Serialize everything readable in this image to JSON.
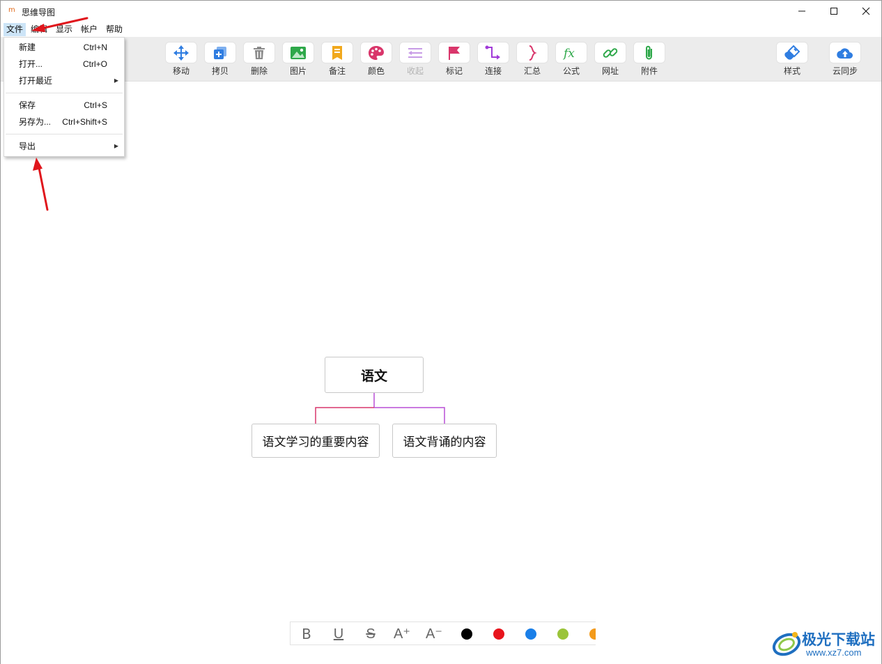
{
  "window": {
    "app_icon": "m",
    "title": "思维导图",
    "controls": {
      "minimize": "minimize-icon",
      "maximize": "maximize-icon",
      "close": "close-icon"
    }
  },
  "menubar": {
    "items": [
      {
        "label": "文件",
        "active": true
      },
      {
        "label": "编辑"
      },
      {
        "label": "显示"
      },
      {
        "label": "帐户"
      },
      {
        "label": "帮助"
      }
    ]
  },
  "toolbar": {
    "tools": [
      {
        "label": "移动",
        "icon": "move-arrows-icon",
        "color": "#2f7de1"
      },
      {
        "label": "拷贝",
        "icon": "copy-icon",
        "color": "#2f7de1"
      },
      {
        "label": "删除",
        "icon": "trash-icon",
        "color": "#8a8a8a"
      },
      {
        "label": "图片",
        "icon": "image-icon",
        "color": "#2ea84a"
      },
      {
        "label": "备注",
        "icon": "note-icon",
        "color": "#f1a81c"
      },
      {
        "label": "颜色",
        "icon": "palette-icon",
        "color": "#d9366b"
      },
      {
        "label": "收起",
        "icon": "collapse-icon",
        "color": "#c79be6",
        "disabled": true
      },
      {
        "label": "标记",
        "icon": "flag-icon",
        "color": "#d9366b"
      },
      {
        "label": "连接",
        "icon": "connect-icon",
        "color": "#a13ad8"
      },
      {
        "label": "汇总",
        "icon": "summary-brace-icon",
        "color": "#d9366b"
      },
      {
        "label": "公式",
        "icon": "formula-icon",
        "color": "#2ea84a"
      },
      {
        "label": "网址",
        "icon": "link-icon",
        "color": "#2ea84a"
      },
      {
        "label": "附件",
        "icon": "paperclip-icon",
        "color": "#2ea84a"
      },
      {
        "label": "样式",
        "icon": "style-brush-icon",
        "color": "#2f7de1"
      },
      {
        "label": "云同步",
        "icon": "cloud-upload-icon",
        "color": "#2f7de1"
      }
    ]
  },
  "file_menu": {
    "items": [
      {
        "label": "新建",
        "shortcut": "Ctrl+N"
      },
      {
        "label": "打开...",
        "shortcut": "Ctrl+O"
      },
      {
        "label": "打开最近",
        "shortcut": "",
        "submenu": true
      },
      {
        "label": "保存",
        "shortcut": "Ctrl+S"
      },
      {
        "label": "另存为...",
        "shortcut": "Ctrl+Shift+S"
      },
      {
        "label": "导出",
        "shortcut": "",
        "submenu": true
      }
    ]
  },
  "mindmap": {
    "root": "语文",
    "children": [
      "语文学习的重要内容",
      "语文背诵的内容"
    ],
    "branch_colors": [
      "#d9366b",
      "#b84fd6"
    ]
  },
  "format_bar": {
    "buttons": [
      {
        "label": "B",
        "icon": "bold-icon"
      },
      {
        "label": "U",
        "icon": "underline-icon"
      },
      {
        "label": "S",
        "icon": "strikethrough-icon"
      },
      {
        "label": "A⁺",
        "icon": "font-increase-icon"
      },
      {
        "label": "A⁻",
        "icon": "font-decrease-icon"
      }
    ],
    "colors": [
      "#000000",
      "#e8141c",
      "#1a7fe8",
      "#9ac43a",
      "#f39a1b"
    ]
  },
  "watermark": {
    "name": "极光下载站",
    "url": "www.xz7.com"
  },
  "annotations": {
    "arrow_color": "#e0161c"
  }
}
